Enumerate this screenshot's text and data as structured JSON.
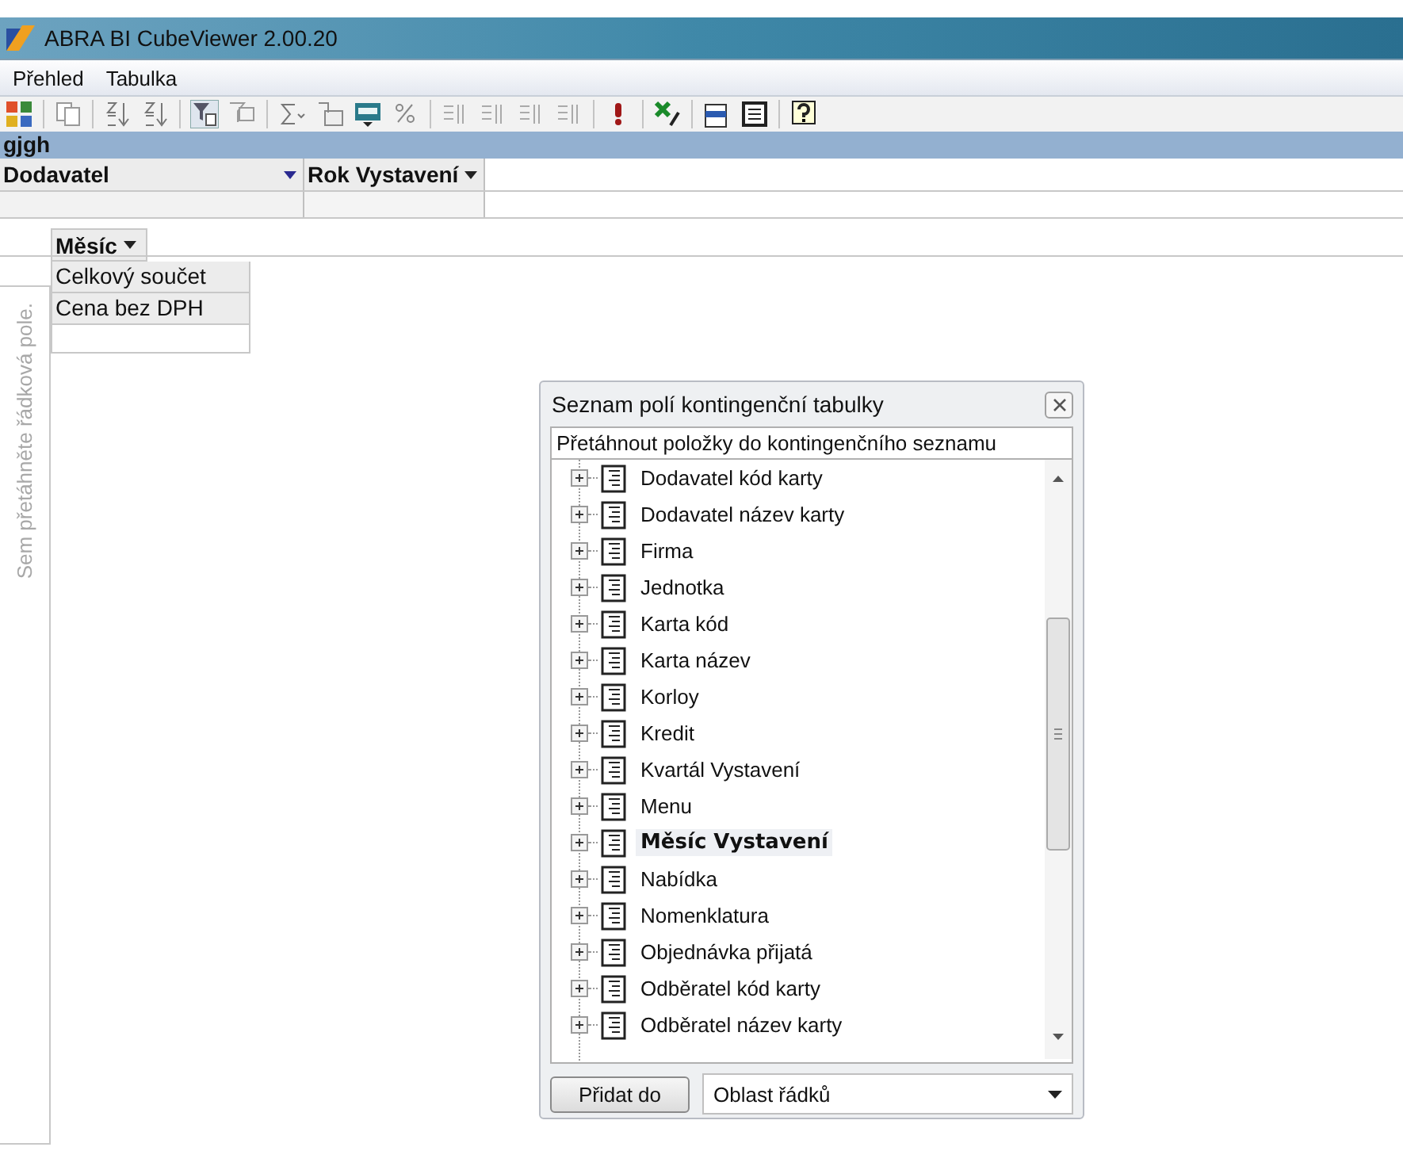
{
  "window": {
    "title": "ABRA BI CubeViewer 2.00.20"
  },
  "menu": [
    {
      "label": "Přehled"
    },
    {
      "label": "Tabulka"
    }
  ],
  "pivot": {
    "title": "gjgh",
    "column_fields": [
      {
        "label": "Dodavatel"
      },
      {
        "label": "Rok Vystavení"
      }
    ],
    "row_field": "Měsíc",
    "cells": [
      "Celkový součet",
      "Cena bez DPH"
    ],
    "row_drop_hint": "Sem přetáhněte řádková pole."
  },
  "field_list": {
    "title": "Seznam polí kontingenční tabulky",
    "subtitle": "Přetáhnout položky do kontingenčního seznamu",
    "items": [
      {
        "label": "Dodavatel kód karty",
        "in_use": false
      },
      {
        "label": "Dodavatel název karty",
        "in_use": false
      },
      {
        "label": "Firma",
        "in_use": false
      },
      {
        "label": "Jednotka",
        "in_use": false
      },
      {
        "label": "Karta kód",
        "in_use": false
      },
      {
        "label": "Karta název",
        "in_use": false
      },
      {
        "label": "Korloy",
        "in_use": false
      },
      {
        "label": "Kredit",
        "in_use": false
      },
      {
        "label": "Kvartál Vystavení",
        "in_use": false
      },
      {
        "label": "Menu",
        "in_use": false
      },
      {
        "label": "Měsíc Vystavení",
        "in_use": true
      },
      {
        "label": "Nabídka",
        "in_use": false
      },
      {
        "label": "Nomenklatura",
        "in_use": false
      },
      {
        "label": "Objednávka přijatá",
        "in_use": false
      },
      {
        "label": "Odběratel kód karty",
        "in_use": false
      },
      {
        "label": "Odběratel název karty",
        "in_use": false
      }
    ],
    "add_button": "Přidat do",
    "area_select": {
      "value": "Oblast řádků"
    }
  }
}
